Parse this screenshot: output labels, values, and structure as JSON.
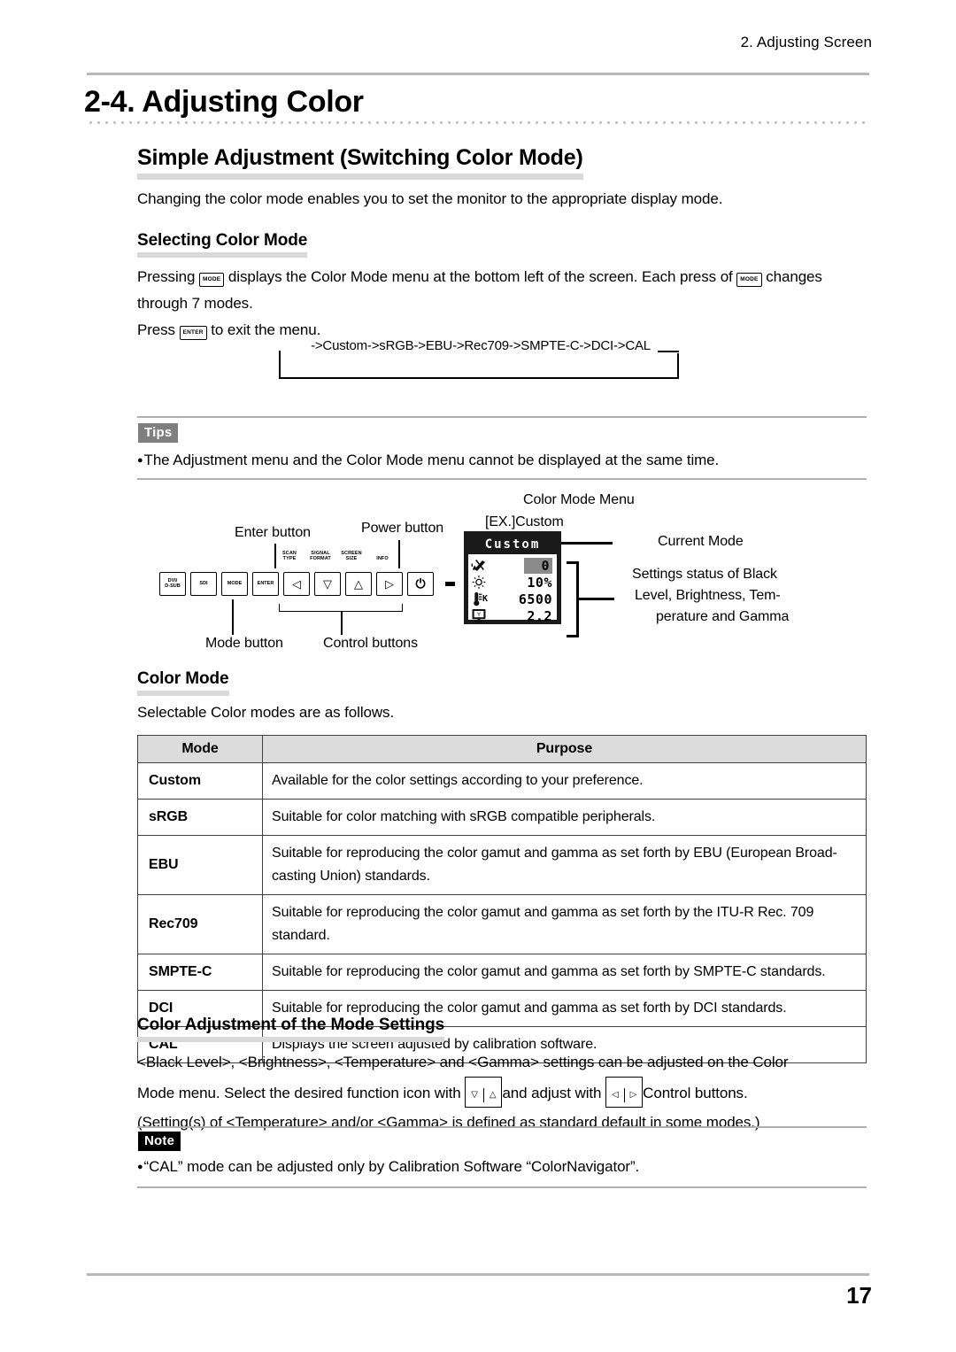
{
  "header": {
    "running_head": "2. Adjusting Screen"
  },
  "chapter": {
    "title": "2-4. Adjusting Color"
  },
  "section_simple": {
    "heading": "Simple Adjustment (Switching Color Mode)",
    "intro": "Changing the color mode enables you to set the monitor to the appropriate display mode."
  },
  "selecting": {
    "heading": "Selecting Color Mode",
    "line1_part1": "Pressing",
    "key_mode": "MODE",
    "line1_part2": "displays the Color Mode menu at the bottom left of the screen. Each press of",
    "line1_part3": "changes",
    "line2": "through 7 modes.",
    "line3_part1": "Press",
    "key_enter": "ENTER",
    "line3_part2": "to exit the menu.",
    "cycle": "->Custom->sRGB->EBU->Rec709->SMPTE-C->DCI->CAL"
  },
  "tips": {
    "badge": "Tips",
    "bullet": "The Adjustment menu and the Color Mode menu cannot be displayed at the same time."
  },
  "figure": {
    "label_enter_button": "Enter button",
    "label_power_button": "Power button",
    "label_mode_button": "Mode button",
    "label_control_buttons": "Control buttons",
    "label_color_mode_menu": "Color Mode Menu",
    "label_ex_custom": "[EX.]Custom",
    "label_current_mode": "Current Mode",
    "label_settings_status_l1": "Settings status of Black",
    "label_settings_status_l2": "Level, Brightness, Tem-",
    "label_settings_status_l3": "perature and Gamma",
    "buttons": [
      {
        "name": "input-dvi-dsub-button",
        "line1": "DVI/",
        "line2": "D-SUB",
        "caption": ""
      },
      {
        "name": "input-sdi-button",
        "line1": "SDI",
        "line2": "",
        "caption": ""
      },
      {
        "name": "mode-button",
        "line1": "MODE",
        "line2": "",
        "caption": ""
      },
      {
        "name": "enter-button",
        "line1": "ENTER",
        "line2": "",
        "caption": ""
      },
      {
        "name": "left-arrow-button",
        "glyph": "◁",
        "caption_l1": "SCAN",
        "caption_l2": "TYPE"
      },
      {
        "name": "down-arrow-button",
        "glyph": "▽",
        "caption_l1": "SIGNAL",
        "caption_l2": "FORMAT"
      },
      {
        "name": "up-arrow-button",
        "glyph": "△",
        "caption_l1": "SCREEN",
        "caption_l2": "SIZE"
      },
      {
        "name": "right-arrow-button",
        "glyph": "▷",
        "caption_l1": "INFO",
        "caption_l2": ""
      },
      {
        "name": "power-button",
        "glyph": "⏻",
        "caption_l1": "",
        "caption_l2": ""
      }
    ],
    "osd": {
      "title": "Custom",
      "rows": [
        {
          "icon": "black-level-icon",
          "value": "0",
          "highlight": true
        },
        {
          "icon": "brightness-icon",
          "value": "10%",
          "highlight": false
        },
        {
          "icon": "temperature-icon",
          "suffix": "K",
          "value": "6500",
          "highlight": false
        },
        {
          "icon": "gamma-monitor-icon",
          "value": "2.2",
          "highlight": false
        }
      ]
    }
  },
  "color_mode": {
    "heading": "Color Mode",
    "intro": "Selectable Color modes are as follows.",
    "table": {
      "columns": [
        "Mode",
        "Purpose"
      ],
      "rows": [
        {
          "mode": "Custom",
          "purpose": "Available for the color settings according to your preference."
        },
        {
          "mode": "sRGB",
          "purpose": "Suitable for color matching with sRGB compatible peripherals."
        },
        {
          "mode": "EBU",
          "purpose": "Suitable for reproducing the color gamut and gamma as set forth by EBU (European Broad-casting Union) standards."
        },
        {
          "mode": "Rec709",
          "purpose": "Suitable for reproducing the color gamut and gamma as set forth by the ITU-R Rec. 709 standard."
        },
        {
          "mode": "SMPTE-C",
          "purpose": "Suitable for reproducing the color gamut and gamma as set forth by SMPTE-C standards."
        },
        {
          "mode": "DCI",
          "purpose": "Suitable for reproducing the color gamut and gamma as set forth by DCI standards."
        },
        {
          "mode": "CAL",
          "purpose": "Displays the screen adjusted by calibration software."
        }
      ]
    }
  },
  "adjustment": {
    "heading": "Color Adjustment of the Mode Settings",
    "line1": "<Black Level>, <Brightness>, <Temperature> and <Gamma> settings can be adjusted on the Color",
    "line2_part1": "Mode menu. Select the desired function icon with",
    "key_down": "▽",
    "key_up": "△",
    "line2_part2": "and adjust with",
    "key_left": "◁",
    "key_right": "▷",
    "line2_part3": "Control buttons.",
    "line3": "(Setting(s) of <Temperature> and/or <Gamma> is defined as standard default in some modes.)"
  },
  "note": {
    "badge": "Note",
    "bullet": "“CAL” mode can be adjusted only by Calibration Software “ColorNavigator”."
  },
  "footer": {
    "page_number": "17"
  }
}
